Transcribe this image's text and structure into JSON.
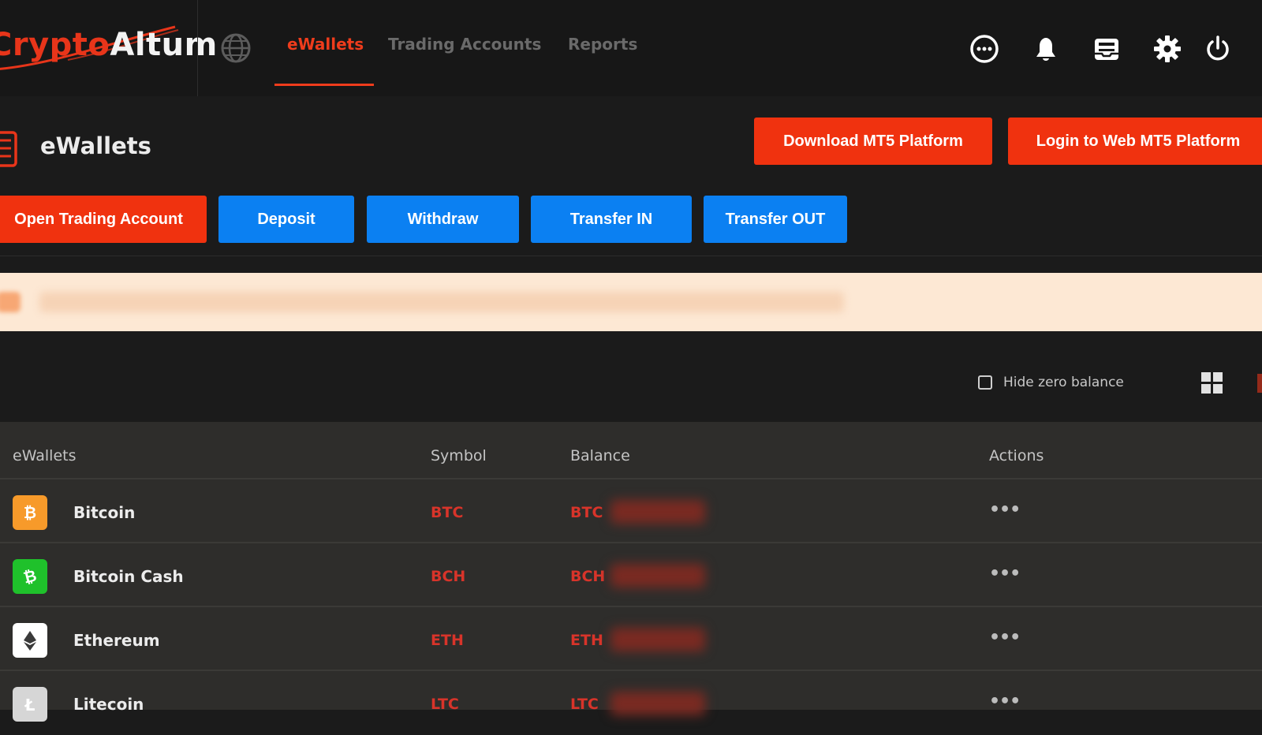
{
  "brand": {
    "part1": "Crypto",
    "part2": "Altum"
  },
  "nav": {
    "ewallets": "eWallets",
    "trading_accounts": "Trading Accounts",
    "reports": "Reports"
  },
  "header_icons": [
    "chat-icon",
    "bell-icon",
    "inbox-icon",
    "gear-icon",
    "power-icon"
  ],
  "page": {
    "title": "eWallets"
  },
  "platform_buttons": {
    "download": "Download MT5 Platform",
    "login_web": "Login to Web MT5 Platform"
  },
  "action_buttons": {
    "open_trading": "Open Trading Account",
    "deposit": "Deposit",
    "withdraw": "Withdraw",
    "transfer_in": "Transfer IN",
    "transfer_out": "Transfer OUT"
  },
  "filters": {
    "hide_zero_label": "Hide zero balance"
  },
  "table": {
    "columns": {
      "wallet": "eWallets",
      "symbol": "Symbol",
      "balance": "Balance",
      "actions": "Actions"
    },
    "rows": [
      {
        "name": "Bitcoin",
        "symbol": "BTC",
        "balance_prefix": "BTC",
        "actions": "•••",
        "icon": "bitcoin-icon",
        "icon_color": "#f79a2a"
      },
      {
        "name": "Bitcoin Cash",
        "symbol": "BCH",
        "balance_prefix": "BCH",
        "actions": "•••",
        "icon": "bitcoin-cash-icon",
        "icon_color": "#1fc12b"
      },
      {
        "name": "Ethereum",
        "symbol": "ETH",
        "balance_prefix": "ETH",
        "actions": "•••",
        "icon": "ethereum-icon",
        "icon_color": "#ffffff"
      },
      {
        "name": "Litecoin",
        "symbol": "LTC",
        "balance_prefix": "LTC",
        "actions": "•••",
        "icon": "litecoin-icon",
        "icon_color": "#d6d6d6"
      }
    ]
  },
  "colors": {
    "accent": "#f0320f",
    "primary_blue": "#0b80f2",
    "banner": "#fde8d4",
    "symbol_red": "#d8342a"
  }
}
